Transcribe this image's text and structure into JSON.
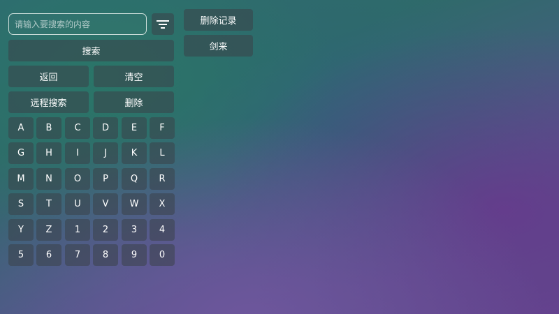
{
  "search": {
    "placeholder": "请输入要搜索的内容",
    "value": "",
    "filter_icon": "filter-lines-icon"
  },
  "actions": {
    "search_label": "搜索",
    "back_label": "返回",
    "clear_label": "清空",
    "remote_search_label": "远程搜索",
    "delete_label": "删除"
  },
  "keyboard": {
    "keys": [
      "A",
      "B",
      "C",
      "D",
      "E",
      "F",
      "G",
      "H",
      "I",
      "J",
      "K",
      "L",
      "M",
      "N",
      "O",
      "P",
      "Q",
      "R",
      "S",
      "T",
      "U",
      "V",
      "W",
      "X",
      "Y",
      "Z",
      "1",
      "2",
      "3",
      "4",
      "5",
      "6",
      "7",
      "8",
      "9",
      "0"
    ]
  },
  "history": {
    "delete_records_label": "删除记录",
    "items": [
      "剑来"
    ]
  }
}
